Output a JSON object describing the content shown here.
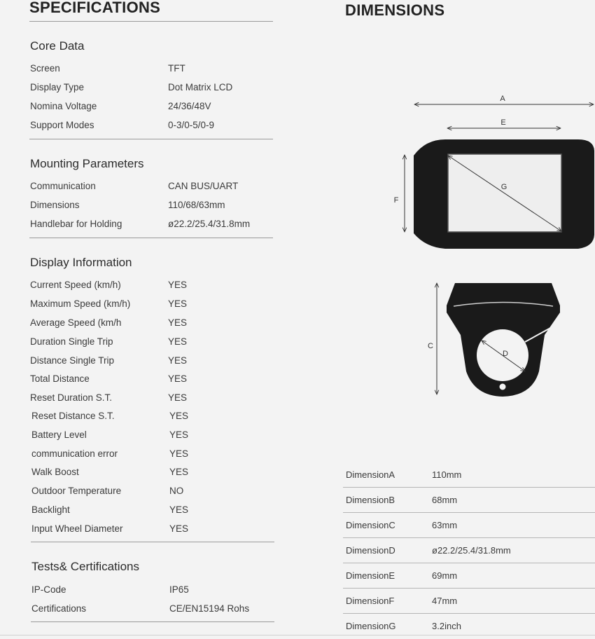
{
  "specifications": {
    "title": "SPECIFICATIONS",
    "sections": [
      {
        "title": "Core Data",
        "rows": [
          {
            "label": "Screen",
            "value": "TFT"
          },
          {
            "label": "Display Type",
            "value": "Dot Matrix LCD"
          },
          {
            "label": "Nomina Voltage",
            "value": "24/36/48V"
          },
          {
            "label": "Support Modes",
            "value": "0-3/0-5/0-9"
          }
        ]
      },
      {
        "title": "Mounting Parameters",
        "rows": [
          {
            "label": "Communication",
            "value": "CAN BUS/UART"
          },
          {
            "label": "Dimensions",
            "value": "110/68/63mm"
          },
          {
            "label": "Handlebar for Holding",
            "value": "ø22.2/25.4/31.8mm"
          }
        ]
      },
      {
        "title": "Display Information",
        "rows": [
          {
            "label": "Current Speed (km/h)",
            "value": "YES"
          },
          {
            "label": "Maximum Speed (km/h)",
            "value": "YES"
          },
          {
            "label": "Average Speed (km/h",
            "value": "YES"
          },
          {
            "label": "Duration Single Trip",
            "value": "YES"
          },
          {
            "label": "Distance Single Trip",
            "value": "YES"
          },
          {
            "label": "Total Distance",
            "value": "YES"
          },
          {
            "label": "Reset Duration S.T.",
            "value": "YES"
          },
          {
            "label": "Reset Distance S.T.",
            "value": "YES"
          },
          {
            "label": "Battery Level",
            "value": "YES"
          },
          {
            "label": "communication error",
            "value": "YES"
          },
          {
            "label": "Walk Boost",
            "value": "YES"
          },
          {
            "label": "Outdoor Temperature",
            "value": "NO"
          },
          {
            "label": "Backlight",
            "value": "YES"
          },
          {
            "label": "Input Wheel Diameter",
            "value": "YES"
          }
        ]
      },
      {
        "title": "Tests& Certifications",
        "rows": [
          {
            "label": "IP-Code",
            "value": "IP65"
          },
          {
            "label": "Certifications",
            "value": "CE/EN15194 Rohs"
          }
        ]
      }
    ]
  },
  "dimensions": {
    "title": "DIMENSIONS",
    "diagram_labels": {
      "a": "A",
      "b": "E",
      "c": "F",
      "d": "G",
      "e": "C",
      "f": "D"
    },
    "table": [
      {
        "label": "DimensionA",
        "value": "110mm"
      },
      {
        "label": "DimensionB",
        "value": "68mm"
      },
      {
        "label": "DimensionC",
        "value": "63mm"
      },
      {
        "label": "DimensionD",
        "value": "ø22.2/25.4/31.8mm"
      },
      {
        "label": "DimensionE",
        "value": "69mm"
      },
      {
        "label": "DimensionF",
        "value": "47mm"
      },
      {
        "label": "DimensionG",
        "value": "3.2inch"
      }
    ]
  },
  "colors": {
    "background": "#f3f3f3",
    "display_body": "#1a1a1a",
    "screen": "#eeeeee"
  }
}
